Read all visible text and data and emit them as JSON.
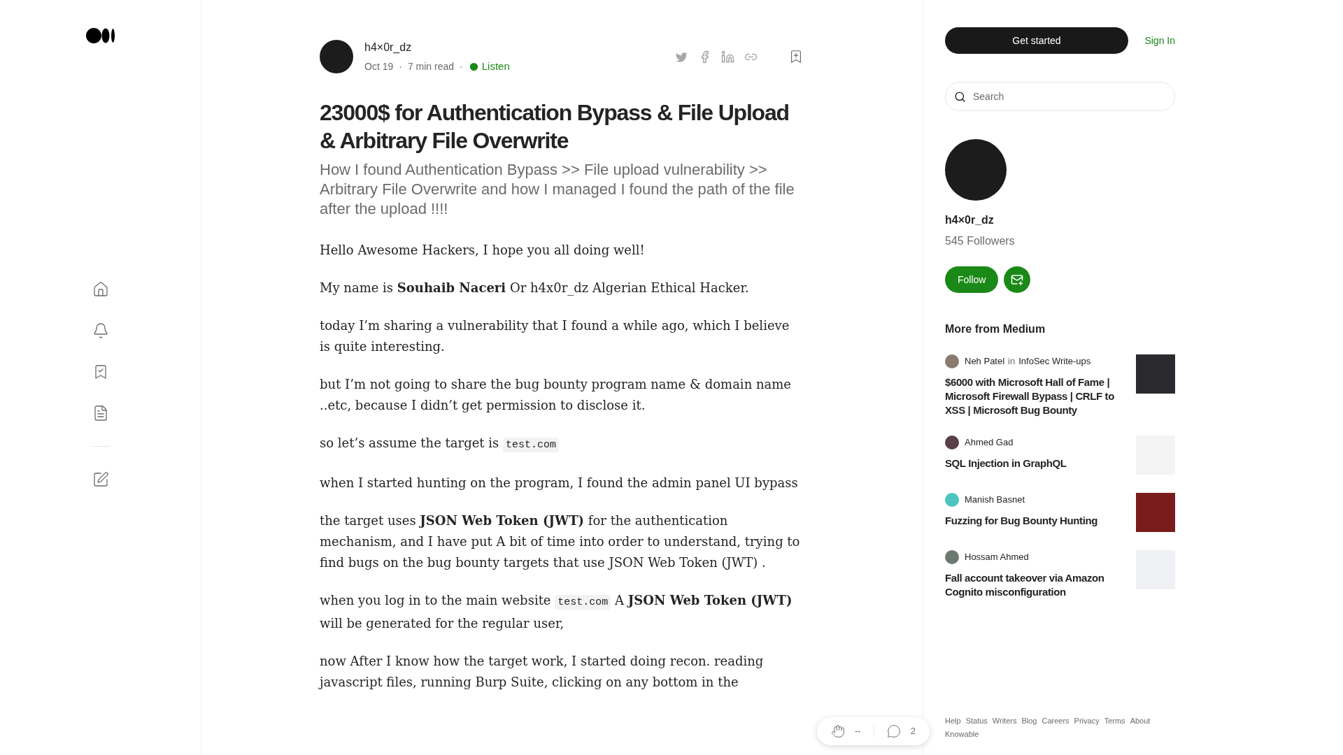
{
  "article": {
    "author": "h4×0r_dz",
    "date": "Oct 19",
    "read_time": "7 min read",
    "separator": "·",
    "listen": "Listen",
    "title": "23000$ for Authentication Bypass & File Upload & Arbitrary File Overwrite",
    "subtitle": "How I found Authentication Bypass >> File upload vulnerability >> Arbitrary File Overwrite and how I managed I found the path of the file after the upload !!!!",
    "paragraphs": [
      [
        {
          "kind": "text",
          "text": "Hello Awesome Hackers, I hope you all doing well!"
        }
      ],
      [
        {
          "kind": "text",
          "text": "My name is **Souhaib Naceri** Or h4x0r_dz Algerian Ethical Hacker."
        }
      ],
      [
        {
          "kind": "text",
          "text": "today I’m sharing a vulnerability that I found a while ago, which I believe is quite interesting."
        }
      ],
      [
        {
          "kind": "text",
          "text": "but I’m not going to share the bug bounty program name & domain name ..etc, because I didn’t get permission to disclose it."
        }
      ],
      [
        {
          "kind": "text",
          "text": "so let’s assume the target is "
        },
        {
          "kind": "code",
          "text": "test.com"
        }
      ],
      [
        {
          "kind": "text",
          "text": "when I started hunting on the program, I found the admin panel UI bypass"
        }
      ],
      [
        {
          "kind": "text",
          "text": "the target uses **JSON Web Token (JWT)** for the authentication mechanism, and I have put A bit of time into order to understand, trying to find bugs on the bug bounty targets that use JSON Web Token (JWT) ."
        }
      ],
      [
        {
          "kind": "text",
          "text": "when you log in to the main website "
        },
        {
          "kind": "code",
          "text": "test.com"
        },
        {
          "kind": "text",
          "text": " A **JSON Web Token (JWT)** will be generated for the regular user,"
        }
      ],
      [
        {
          "kind": "text",
          "text": "now After I know how the target work, I started doing recon. reading javascript files, running Burp Suite, clicking on any bottom in the"
        }
      ]
    ]
  },
  "actions": {
    "claps": "--",
    "responses": "2"
  },
  "sidebar": {
    "get_started": "Get started",
    "sign_in": "Sign In",
    "search": {
      "placeholder": "Search"
    },
    "profile": {
      "name": "h4×0r_dz",
      "followers": "545 Followers",
      "follow": "Follow"
    },
    "more_title": "More from Medium",
    "stories": [
      {
        "author": "Neh Patel",
        "in": "in",
        "publication": "InfoSec Write-ups",
        "title": "$6000 with Microsoft Hall of Fame | Microsoft Firewall Bypass | CRLF to XSS | Microsoft Bug Bounty"
      },
      {
        "author": "Ahmed Gad",
        "title": "SQL Injection in GraphQL"
      },
      {
        "author": "Manish Basnet",
        "title": "Fuzzing for Bug Bounty Hunting"
      },
      {
        "author": "Hossam Ahmed",
        "title": "Fall account takeover via Amazon Cognito misconfiguration"
      }
    ],
    "footer": [
      "Help",
      "Status",
      "Writers",
      "Blog",
      "Careers",
      "Privacy",
      "Terms",
      "About",
      "Knowable"
    ]
  }
}
